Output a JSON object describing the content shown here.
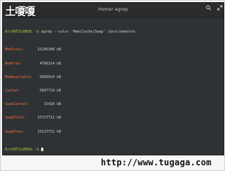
{
  "window": {
    "title": "Homer egrep",
    "logo_text": "土嗄嗄",
    "search_icon": "search-icon",
    "expand_icon": "expand-icon"
  },
  "terminal": {
    "command_line": {
      "prompt": "ArchBTSidHEAL ~$",
      "command": " egrep --color 'Mem|Cache|Swap' /proc/meminfo"
    },
    "rows": [
      {
        "label": "MemTotal:",
        "value": "15246348",
        "unit": "kB"
      },
      {
        "label": "MemFree:",
        "value": "4706314",
        "unit": "kB"
      },
      {
        "label": "MemAvailable:",
        "value": "9389924",
        "unit": "kB"
      },
      {
        "label": "Cached:",
        "value": "5897724",
        "unit": "kB"
      },
      {
        "label": "SwapCached:",
        "value": "15428",
        "unit": "kB"
      },
      {
        "label": "SwapTotal:",
        "value": "15727712",
        "unit": "kB"
      },
      {
        "label": "SwapFree:",
        "value": "15137752",
        "unit": "kB"
      }
    ],
    "final_prompt": "ArchBTSidHEAL ~$"
  },
  "watermark": "http://www.tugaga.com"
}
